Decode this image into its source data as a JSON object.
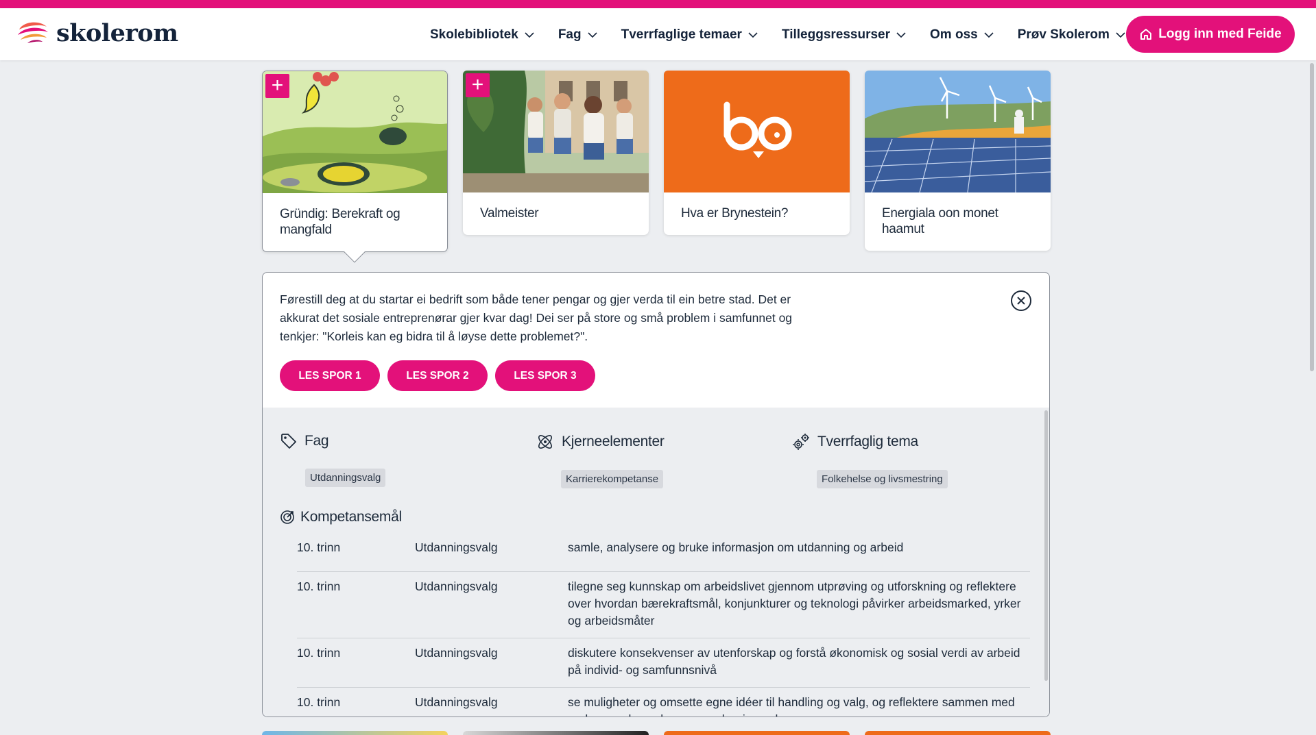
{
  "header": {
    "logo_text": "skolerom",
    "nav": [
      {
        "label": "Skolebibliotek"
      },
      {
        "label": "Fag"
      },
      {
        "label": "Tverrfaglige temaer"
      },
      {
        "label": "Tilleggsressurser"
      },
      {
        "label": "Om oss"
      },
      {
        "label": "Prøv Skolerom"
      }
    ],
    "login_label": "Logg inn med Feide"
  },
  "cards": [
    {
      "title": "Gründig: Berekraft og mangfald",
      "has_plus": true,
      "active": true
    },
    {
      "title": "Valmeister",
      "has_plus": true,
      "active": false
    },
    {
      "title": "Hva er Brynestein?",
      "has_plus": false,
      "active": false
    },
    {
      "title": "Energiala oon monet haamut",
      "has_plus": false,
      "active": false
    }
  ],
  "panel": {
    "description": "Førestill deg at du startar ei bedrift som både tener pengar og gjer verda til ein betre stad. Det er akkurat det sosiale entreprenørar gjer kvar dag! Dei ser på store og små problem i samfunnet og tenkjer: \"Korleis kan eg bidra til å løyse dette problemet?\".",
    "spor_buttons": [
      "LES SPOR 1",
      "LES SPOR 2",
      "LES SPOR 3"
    ],
    "fag": {
      "heading": "Fag",
      "tag": "Utdanningsvalg"
    },
    "kjerneelementer": {
      "heading": "Kjerneelementer",
      "tag": "Karrierekompetanse"
    },
    "tverrfaglig": {
      "heading": "Tverrfaglig tema",
      "tag": "Folkehelse og livsmestring"
    },
    "kompetansemal_heading": "Kompetansemål",
    "kompetansemal": [
      {
        "trinn": "10. trinn",
        "fag": "Utdanningsvalg",
        "text": "samle, analysere og bruke informasjon om utdanning og arbeid"
      },
      {
        "trinn": "10. trinn",
        "fag": "Utdanningsvalg",
        "text": "tilegne seg kunnskap om arbeidslivet gjennom utprøving og utforskning og reflektere over hvordan bærekraftsmål, konjunkturer og teknologi påvirker arbeidsmarked, yrker og arbeidsmåter"
      },
      {
        "trinn": "10. trinn",
        "fag": "Utdanningsvalg",
        "text": "diskutere konsekvenser av utenforskap og forstå økonomisk og sosial verdi av arbeid på individ- og samfunnsnivå"
      },
      {
        "trinn": "10. trinn",
        "fag": "Utdanningsvalg",
        "text": "se muligheter og omsette egne idéer til handling og valg, og reflektere sammen med andre over konsekvenser av karrierevalg"
      }
    ]
  },
  "colors": {
    "accent": "#e3117a",
    "text": "#14233a",
    "background": "#eceef1",
    "orange": "#ee6b1a"
  }
}
